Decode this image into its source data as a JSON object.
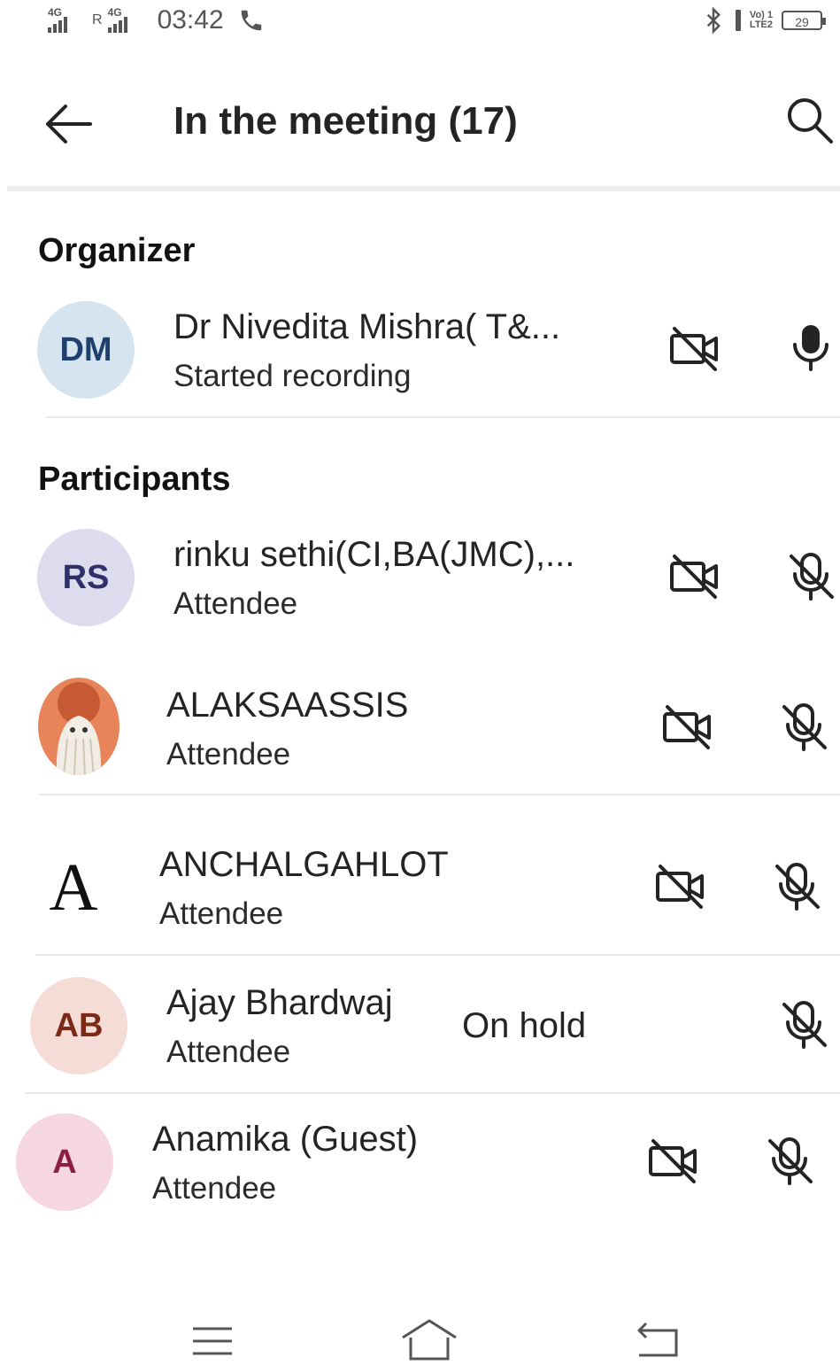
{
  "status_bar": {
    "network_1": "4G",
    "roaming": "R",
    "network_2": "4G",
    "time": "03:42",
    "volte_line1": "Vo) 1",
    "volte_line2": "LTE2",
    "battery": "29"
  },
  "header": {
    "title": "In the meeting (17)"
  },
  "sections": {
    "organizer": "Organizer",
    "participants": "Participants"
  },
  "organizer": {
    "initials": "DM",
    "name": "Dr Nivedita  Mishra( T&...",
    "status": "Started recording",
    "avatar_bg": "#d6e4f0",
    "avatar_fg": "#1f3f6e"
  },
  "participants": [
    {
      "initials": "RS",
      "name": "rinku sethi(CI,BA(JMC),...",
      "role": "Attendee",
      "avatar_bg": "#dcdcee",
      "avatar_fg": "#2f2f6a"
    },
    {
      "initials": "",
      "name": "ALAKSAASSIS",
      "role": "Attendee",
      "avatar_type": "photo"
    },
    {
      "initials": "A",
      "name": "ANCHALGAHLOT",
      "role": "Attendee",
      "avatar_type": "letter-serif"
    },
    {
      "initials": "AB",
      "name": "Ajay Bhardwaj",
      "role": "Attendee",
      "state": "On hold",
      "avatar_bg": "#f6dcd6",
      "avatar_fg": "#7a2a16"
    },
    {
      "initials": "A",
      "name": "Anamika (Guest)",
      "role": "Attendee",
      "avatar_bg": "#f6d6e0",
      "avatar_fg": "#8a1f44"
    }
  ],
  "colors": {
    "text": "#242424",
    "divider": "#e8e8e8"
  }
}
